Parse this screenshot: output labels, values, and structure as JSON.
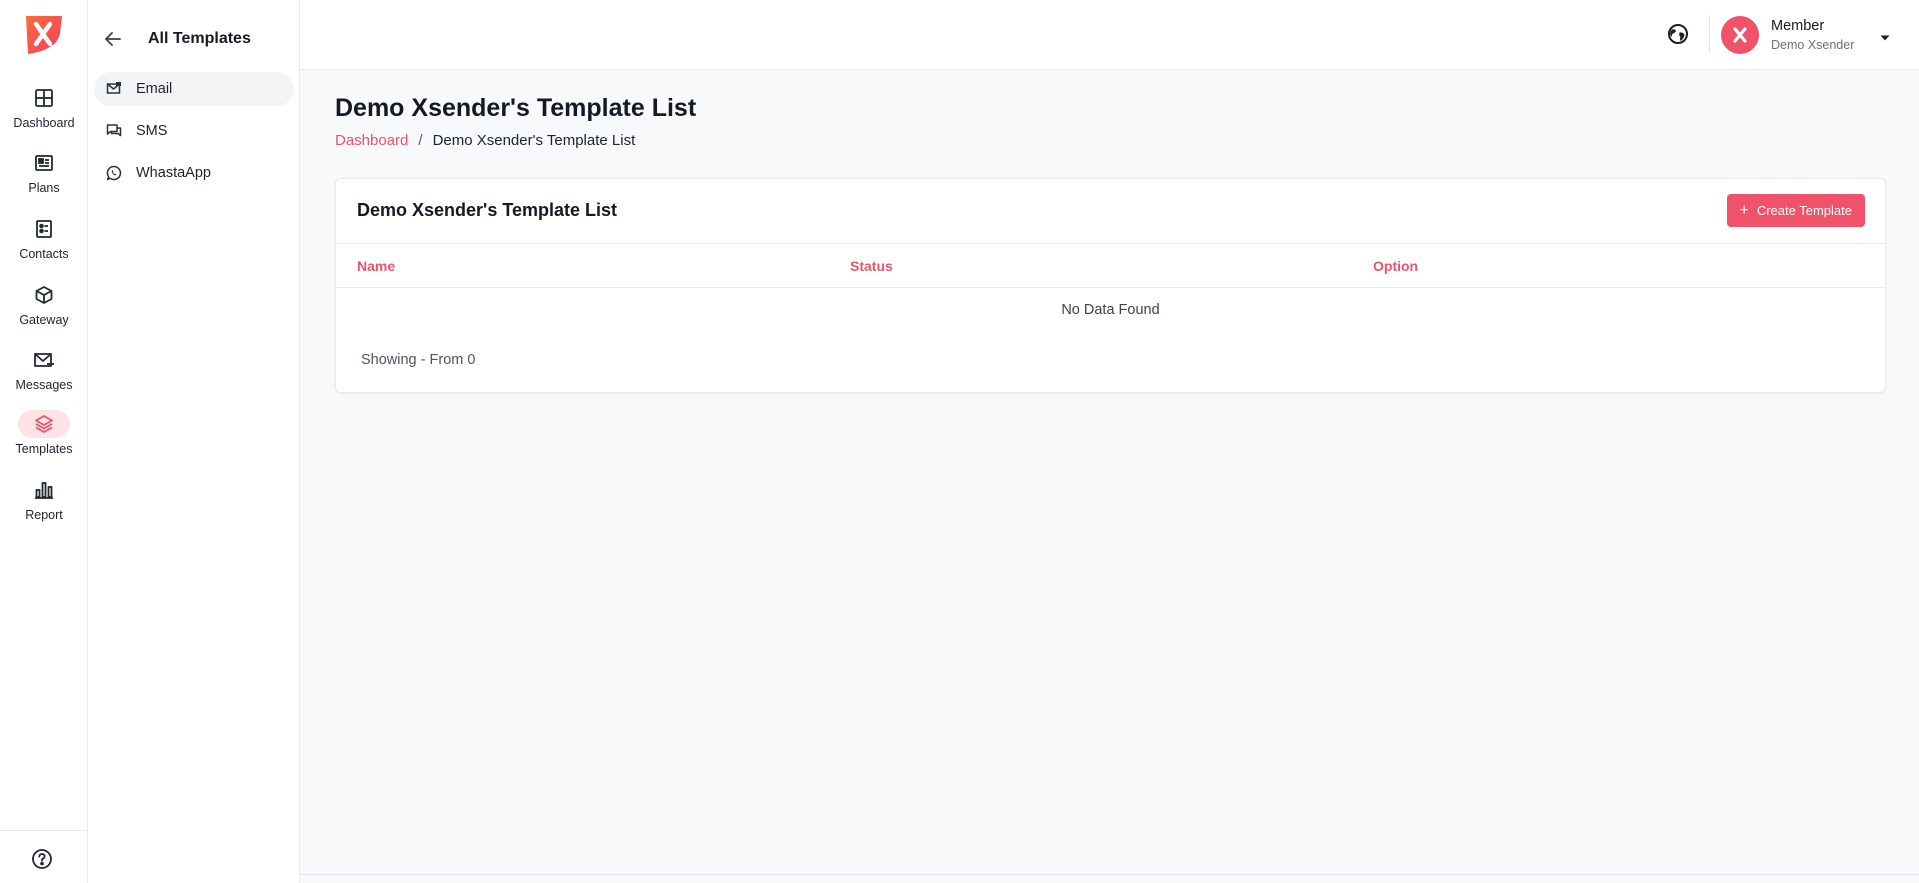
{
  "rail": {
    "items": [
      {
        "label": "Dashboard",
        "icon": "grid-icon"
      },
      {
        "label": "Plans",
        "icon": "newspaper-icon"
      },
      {
        "label": "Contacts",
        "icon": "contacts-list-icon"
      },
      {
        "label": "Gateway",
        "icon": "cube-icon"
      },
      {
        "label": "Messages",
        "icon": "mail-send-icon"
      },
      {
        "label": "Templates",
        "icon": "layers-icon",
        "active": true
      },
      {
        "label": "Report",
        "icon": "bar-chart-icon"
      }
    ],
    "footer_icon": "help-circle-icon"
  },
  "subbar": {
    "title": "All Templates",
    "items": [
      {
        "label": "Email",
        "icon": "email-template-icon",
        "active": true
      },
      {
        "label": "SMS",
        "icon": "chat-bubbles-icon"
      },
      {
        "label": "WhastaApp",
        "icon": "whatsapp-icon"
      }
    ]
  },
  "topbar": {
    "profile_name": "Member",
    "profile_sub": "Demo Xsender"
  },
  "page": {
    "title": "Demo Xsender's Template List",
    "breadcrumb_home": "Dashboard",
    "breadcrumb_sep": "/",
    "breadcrumb_current": "Demo Xsender's Template List"
  },
  "card": {
    "title": "Demo Xsender's Template List",
    "create_plus": "+",
    "create_label": "Create Template",
    "columns": [
      "Name",
      "Status",
      "Option"
    ],
    "empty_text": "No Data Found",
    "showing_text": "Showing - From 0"
  },
  "colors": {
    "accent": "#ef5269",
    "accent_soft": "#fde3e6",
    "background": "#f8f9fb"
  }
}
